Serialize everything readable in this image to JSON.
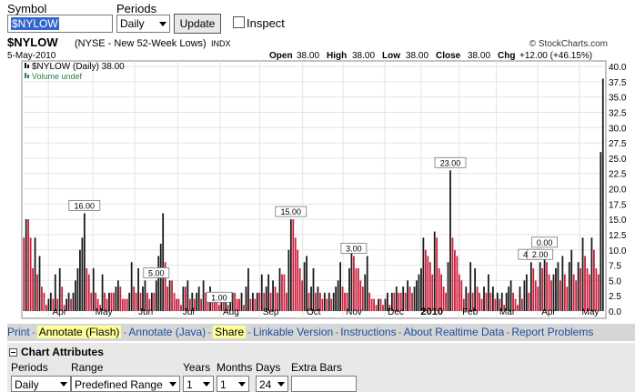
{
  "form": {
    "symbol_label": "Symbol",
    "symbol_value": "$NYLOW",
    "periods_label": "Periods",
    "periods_value": "Daily",
    "update_label": "Update",
    "inspect_label": "Inspect"
  },
  "header": {
    "symbol": "$NYLOW",
    "description": "(NYSE - New 52-Week Lows)",
    "exchange": "INDX",
    "credit": "© StockCharts.com",
    "date": "5-May-2010",
    "open_label": "Open",
    "open_value": "38.00",
    "high_label": "High",
    "high_value": "38.00",
    "low_label": "Low",
    "low_value": "38.00",
    "close_label": "Close",
    "close_value": "38.00",
    "chg_label": "Chg",
    "chg_value": "+12.00 (+46.15%)"
  },
  "legend": {
    "series": "$NYLOW (Daily) 38.00",
    "volume": "Volume undef"
  },
  "chart_data": {
    "type": "bar",
    "title": "$NYLOW (NYSE - New 52-Week Lows) INDX",
    "ylim": [
      0,
      40
    ],
    "y_ticks": [
      "0.0",
      "2.5",
      "5.0",
      "7.5",
      "10.0",
      "12.5",
      "15.0",
      "17.5",
      "20.0",
      "22.5",
      "25.0",
      "27.5",
      "30.0",
      "32.5",
      "35.0",
      "37.5",
      "40.0"
    ],
    "x_ticks": [
      {
        "label": "Apr",
        "at": 0.07
      },
      {
        "label": "May",
        "at": 0.155
      },
      {
        "label": "Jun",
        "at": 0.235
      },
      {
        "label": "Jul",
        "at": 0.317
      },
      {
        "label": "Aug",
        "at": 0.398
      },
      {
        "label": "Sep",
        "at": 0.474
      },
      {
        "label": "Oct",
        "at": 0.556
      },
      {
        "label": "Nov",
        "at": 0.633
      },
      {
        "label": "Dec",
        "at": 0.713
      },
      {
        "label": "2010",
        "at": 0.782,
        "bold": true
      },
      {
        "label": "Feb",
        "at": 0.855
      },
      {
        "label": "Mar",
        "at": 0.926
      },
      {
        "label": "Apr",
        "at": 1.005
      },
      {
        "label": "May",
        "at": 1.085
      }
    ],
    "values": [
      12,
      15,
      15,
      12,
      7,
      12,
      6,
      9,
      4,
      3,
      1,
      2,
      3,
      2,
      6,
      2,
      7,
      4,
      1,
      2,
      3,
      2,
      3,
      5,
      7,
      10,
      12,
      16,
      7,
      6,
      3,
      7,
      3,
      2,
      1,
      6,
      3,
      2,
      3,
      3,
      3,
      4,
      5,
      4,
      2,
      2,
      2,
      3,
      8,
      4,
      3,
      7,
      3,
      4,
      5,
      3,
      2,
      3,
      3,
      5,
      9,
      11,
      16,
      8,
      4,
      5,
      5,
      3,
      2,
      2,
      1,
      4,
      4,
      5,
      2,
      3,
      2,
      3,
      4,
      2,
      5,
      3,
      3,
      4,
      2,
      2,
      2,
      1,
      2,
      2,
      3,
      1,
      2,
      3,
      3,
      2,
      2,
      3,
      1,
      4,
      7,
      2,
      3,
      2,
      3,
      3,
      6,
      3,
      4,
      6,
      3,
      5,
      4,
      3,
      7,
      6,
      6,
      3,
      10,
      15,
      15,
      12,
      10,
      7,
      5,
      8,
      9,
      3,
      4,
      7,
      3,
      4,
      3,
      2,
      3,
      2,
      3,
      2,
      3,
      4,
      5,
      8,
      4,
      3,
      3,
      7,
      10,
      9,
      7,
      7,
      5,
      4,
      6,
      9,
      3,
      2,
      2,
      1,
      2,
      2,
      1,
      2,
      3,
      1,
      3,
      3,
      4,
      3,
      3,
      4,
      3,
      5,
      4,
      3,
      4,
      5,
      6,
      7,
      12,
      10,
      9,
      8,
      6,
      13,
      12,
      7,
      6,
      4,
      3,
      8,
      23,
      12,
      10,
      9,
      6,
      5,
      2,
      4,
      3,
      8,
      3,
      7,
      4,
      3,
      2,
      4,
      3,
      6,
      3,
      4,
      2,
      3,
      2,
      3,
      1,
      3,
      4,
      5,
      3,
      2,
      1,
      4,
      2,
      5,
      6,
      3,
      8,
      7,
      5,
      4,
      8,
      7,
      10,
      8,
      6,
      5,
      6,
      7,
      8,
      5,
      9,
      6,
      4,
      8,
      10,
      6,
      5,
      8,
      7,
      12,
      9,
      7,
      6,
      12,
      10,
      7,
      6,
      26,
      38
    ],
    "annotations": [
      {
        "text": "16.00",
        "index": 27
      },
      {
        "text": "5.00",
        "index": 59
      },
      {
        "text": "1.00",
        "index": 87
      },
      {
        "text": "15.00",
        "index": 119
      },
      {
        "text": "3.00",
        "index": 147
      },
      {
        "text": "23.00",
        "index": 190
      },
      {
        "text": "4.00",
        "index": 226
      },
      {
        "text": "2.00",
        "index": 230
      },
      {
        "text": "0.00",
        "index": 232
      }
    ],
    "colors": {
      "up": "#1a1a1a",
      "down": "#cc1f3c",
      "grid": "#e4e4e4"
    }
  },
  "toolbar": {
    "items": [
      {
        "label": "Print",
        "highlight": false
      },
      {
        "label": "Annotate (Flash)",
        "highlight": true
      },
      {
        "label": "Annotate (Java)",
        "highlight": false
      },
      {
        "label": "Share",
        "highlight": true
      },
      {
        "label": "Linkable Version",
        "highlight": false
      },
      {
        "label": "Instructions",
        "highlight": false
      },
      {
        "label": "About Realtime Data",
        "highlight": false
      },
      {
        "label": "Report Problems",
        "highlight": false
      }
    ]
  },
  "attributes": {
    "title": "Chart Attributes",
    "periods_label": "Periods",
    "periods_value": "Daily",
    "range_label": "Range",
    "range_value": "Predefined Range",
    "years_label": "Years",
    "years_value": "1",
    "months_label": "Months",
    "months_value": "1",
    "days_label": "Days",
    "days_value": "24",
    "extra_bars_label": "Extra Bars",
    "extra_bars_value": ""
  }
}
